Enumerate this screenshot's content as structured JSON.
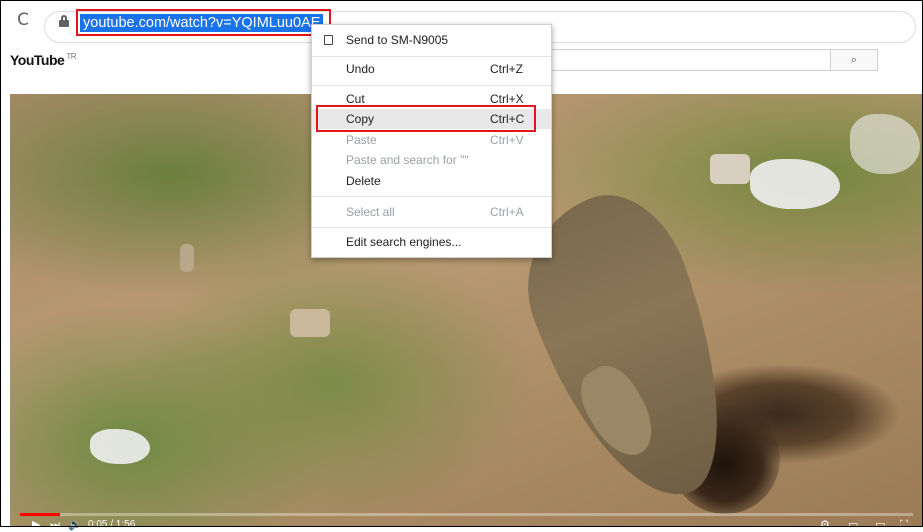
{
  "browser": {
    "url_selected": "youtube.com/watch?v=YQIMLuu0AE",
    "reload_glyph": "C"
  },
  "youtube": {
    "logo": "YouTube",
    "region": "TR",
    "search_glyph": "⌕"
  },
  "player": {
    "play_glyph": "▶",
    "next_glyph": "⏭",
    "volume_glyph": "🔉",
    "time": "0:05 / 1:56",
    "progress_fraction": 0.045
  },
  "context_menu": {
    "items": [
      {
        "label": "Send to SM-N9005",
        "shortcut": "",
        "disabled": false
      },
      {
        "label": "Undo",
        "shortcut": "Ctrl+Z",
        "disabled": false
      },
      {
        "label": "Cut",
        "shortcut": "Ctrl+X",
        "disabled": false
      },
      {
        "label": "Copy",
        "shortcut": "Ctrl+C",
        "disabled": false,
        "highlighted": true
      },
      {
        "label": "Paste",
        "shortcut": "Ctrl+V",
        "disabled": true
      },
      {
        "label": "Paste and search for \"\"",
        "shortcut": "",
        "disabled": true
      },
      {
        "label": "Delete",
        "shortcut": "",
        "disabled": false
      },
      {
        "label": "Select all",
        "shortcut": "Ctrl+A",
        "disabled": true
      },
      {
        "label": "Edit search engines...",
        "shortcut": "",
        "disabled": false
      }
    ]
  },
  "colors": {
    "highlight_box": "#e0161b",
    "selection": "#1a73e8",
    "progress": "#ff0000"
  }
}
